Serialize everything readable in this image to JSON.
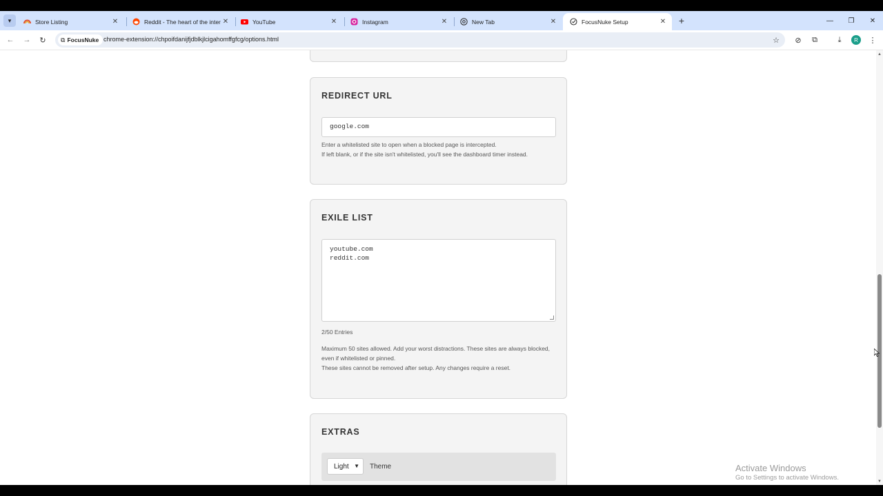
{
  "browser": {
    "tabs": [
      {
        "title": "Store Listing",
        "icon": "rainbow-icon"
      },
      {
        "title": "Reddit - The heart of the intern",
        "icon": "reddit-icon"
      },
      {
        "title": "YouTube",
        "icon": "youtube-icon"
      },
      {
        "title": "Instagram",
        "icon": "instagram-icon"
      },
      {
        "title": "New Tab",
        "icon": "chrome-icon"
      },
      {
        "title": "FocusNuke Setup",
        "icon": "focusnuke-icon"
      }
    ],
    "address": {
      "chip_label": "FocusNuke",
      "url": "chrome-extension://chpoifdanijfjdblkjlcigahomffgfcg/options.html"
    },
    "profile_initial": "R"
  },
  "redirect": {
    "heading": "REDIRECT URL",
    "value": "google.com",
    "hint_line1": "Enter a whitelisted site to open when a blocked page is intercepted.",
    "hint_line2": "If left blank, or if the site isn't whitelisted, you'll see the dashboard timer instead."
  },
  "exile": {
    "heading": "EXILE LIST",
    "entries": [
      "youtube.com",
      "reddit.com"
    ],
    "count": "2/50 Entries",
    "hint_line1": "Maximum 50 sites allowed. Add your worst distractions. These sites are always blocked, even if whitelisted or pinned.",
    "hint_line2": "These sites cannot be removed after setup. Any changes require a reset."
  },
  "extras": {
    "heading": "EXTRAS",
    "theme_value": "Light",
    "theme_label": "Theme"
  },
  "watermark": {
    "line1": "Activate Windows",
    "line2": "Go to Settings to activate Windows."
  }
}
